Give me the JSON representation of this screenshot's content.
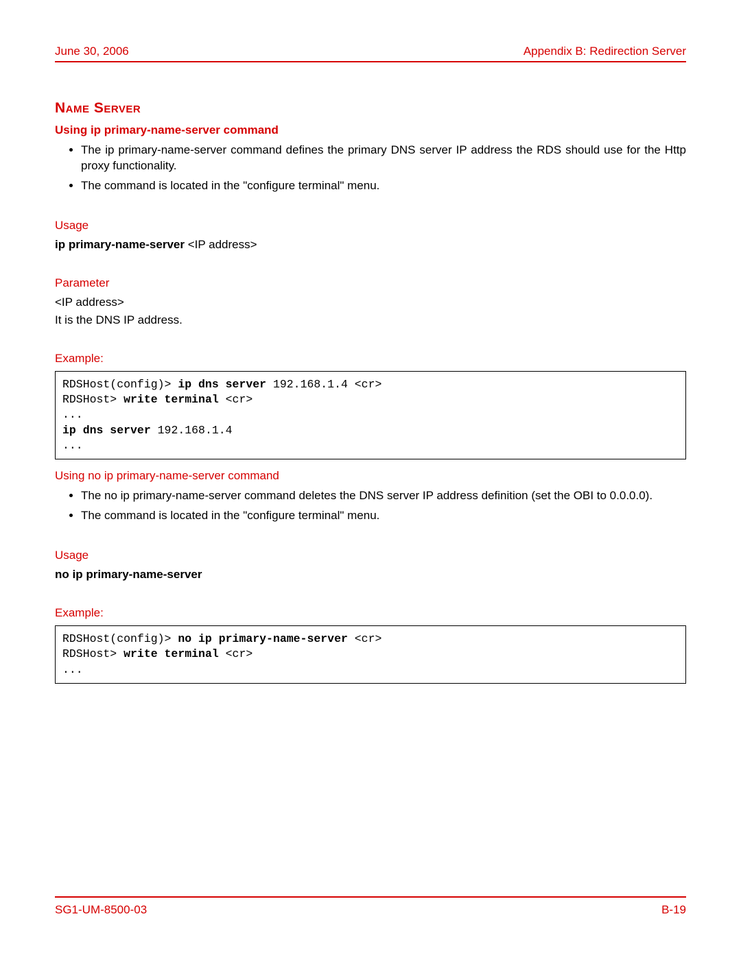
{
  "header": {
    "date": "June 30, 2006",
    "appendix": "Appendix B: Redirection Server"
  },
  "section": {
    "title": "Name Server"
  },
  "sub1": {
    "heading": "Using ip primary-name-server command",
    "bullets": [
      "The ip primary-name-server command defines the primary DNS server IP address the RDS should use for the Http proxy functionality.",
      "The command is located in the \"configure terminal\" menu."
    ],
    "usage_heading": "Usage",
    "usage_bold": "ip primary-name-server",
    "usage_rest": " <IP address>",
    "param_heading": "Parameter",
    "param_name": "<IP address>",
    "param_desc": "It is the DNS IP address.",
    "example_heading": "Example:",
    "code": {
      "l1a": "RDSHost(config)> ",
      "l1b": "ip dns server",
      "l1c": " 192.168.1.4 <cr>",
      "l2a": "RDSHost> ",
      "l2b": "write terminal",
      "l2c": " <cr>",
      "l3": "...",
      "l4a": "ip dns server",
      "l4b": " 192.168.1.4",
      "l5": "..."
    }
  },
  "sub2": {
    "heading": "Using no ip primary-name-server command",
    "bullets": [
      "The no ip primary-name-server command deletes the DNS server IP address definition (set the OBI to 0.0.0.0).",
      "The command is located in the \"configure terminal\" menu."
    ],
    "usage_heading": "Usage",
    "usage_bold": "no ip primary-name-server",
    "example_heading": "Example:",
    "code": {
      "l1a": "RDSHost(config)> ",
      "l1b": "no ip primary-name-server",
      "l1c": " <cr>",
      "l2a": "RDSHost> ",
      "l2b": "write terminal",
      "l2c": " <cr>",
      "l3": "..."
    }
  },
  "footer": {
    "docnum": "SG1-UM-8500-03",
    "pagenum": "B-19"
  }
}
